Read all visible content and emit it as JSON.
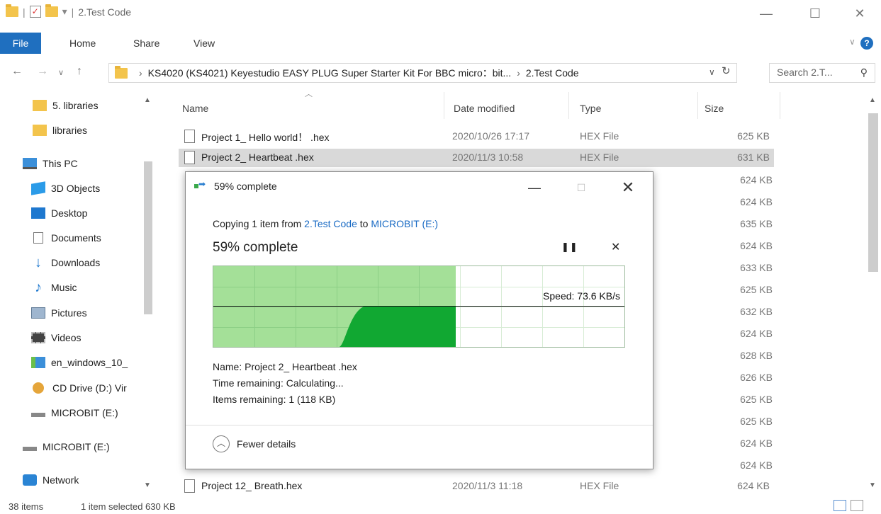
{
  "window": {
    "title": "2.Test Code",
    "minimize": "—",
    "maximize": "☐",
    "close": "✕"
  },
  "ribbon": {
    "file": "File",
    "home": "Home",
    "share": "Share",
    "view": "View",
    "help": "?"
  },
  "address": {
    "crumb_root": "KS4020  (KS4021)   Keyestudio EASY PLUG Super Starter Kit For BBC micro：bit...",
    "crumb_current": "2.Test Code",
    "search_placeholder": "Search 2.T..."
  },
  "sidebar": {
    "items": [
      {
        "label": "5. libraries",
        "icon": "folder-icon"
      },
      {
        "label": "libraries",
        "icon": "folder-icon"
      },
      {
        "label": "This PC",
        "icon": "this-pc-icon"
      },
      {
        "label": "3D Objects",
        "icon": "3d-objects-icon"
      },
      {
        "label": "Desktop",
        "icon": "desktop-icon"
      },
      {
        "label": "Documents",
        "icon": "documents-icon"
      },
      {
        "label": "Downloads",
        "icon": "downloads-icon"
      },
      {
        "label": "Music",
        "icon": "music-icon"
      },
      {
        "label": "Pictures",
        "icon": "pictures-icon"
      },
      {
        "label": "Videos",
        "icon": "videos-icon"
      },
      {
        "label": "en_windows_10_",
        "icon": "setup-drive-icon"
      },
      {
        "label": "CD Drive (D:) Vir",
        "icon": "cd-drive-icon"
      },
      {
        "label": "MICROBIT (E:)",
        "icon": "drive-icon"
      },
      {
        "label": "MICROBIT (E:)",
        "icon": "drive-icon"
      },
      {
        "label": "Network",
        "icon": "network-icon"
      }
    ]
  },
  "filelist": {
    "columns": {
      "name": "Name",
      "date": "Date modified",
      "type": "Type",
      "size": "Size"
    },
    "rows": [
      {
        "name": "Project 1_ Hello world！ .hex",
        "date": "2020/10/26 17:17",
        "type": "HEX File",
        "size": "625 KB"
      },
      {
        "name": "Project 2_ Heartbeat .hex",
        "date": "2020/11/3 10:58",
        "type": "HEX File",
        "size": "631 KB"
      },
      {
        "name": "Project 12_ Breath.hex",
        "date": "2020/11/3 11:18",
        "type": "HEX File",
        "size": "624 KB"
      }
    ],
    "hidden_sizes": [
      "624 KB",
      "624 KB",
      "635 KB",
      "624 KB",
      "633 KB",
      "625 KB",
      "632 KB",
      "624 KB",
      "628 KB",
      "626 KB",
      "625 KB",
      "625 KB",
      "624 KB",
      "624 KB"
    ]
  },
  "statusbar": {
    "items": "38 items",
    "selected": "1 item selected  630 KB"
  },
  "dialog": {
    "title": "59% complete",
    "copy_prefix": "Copying 1 item from ",
    "copy_source": "2.Test Code",
    "copy_mid": " to ",
    "copy_dest": "MICROBIT (E:)",
    "percent_label": "59% complete",
    "progress": 0.59,
    "pause": "❚❚",
    "cancel": "✕",
    "speed": "Speed: 73.6 KB/s",
    "name_line": "Name:  Project 2_ Heartbeat .hex",
    "time_line": "Time remaining:  Calculating...",
    "items_line": "Items remaining:  1 (118 KB)",
    "fewer_details": "Fewer details",
    "minimize": "—",
    "maximize": "☐",
    "close": "✕",
    "colors": {
      "done": "#a4e098",
      "throughput": "#11a832",
      "link": "#1a6bc4"
    }
  }
}
